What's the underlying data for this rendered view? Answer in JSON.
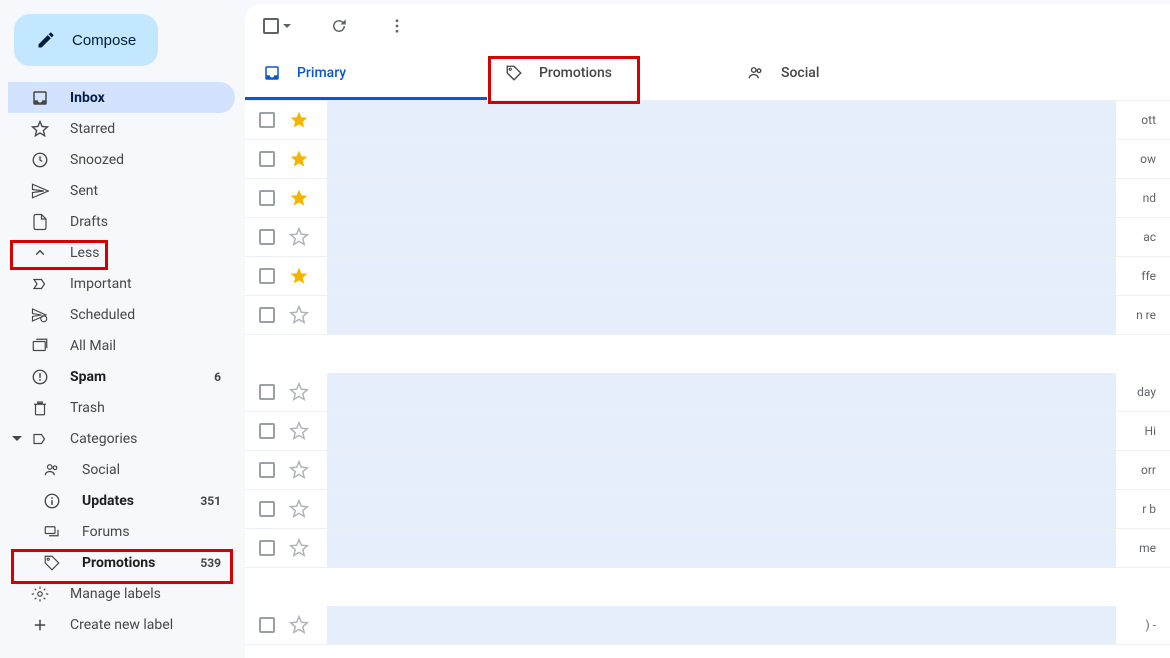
{
  "compose": {
    "label": "Compose"
  },
  "sidebar": {
    "items": [
      {
        "label": "Inbox",
        "count": ""
      },
      {
        "label": "Starred",
        "count": ""
      },
      {
        "label": "Snoozed",
        "count": ""
      },
      {
        "label": "Sent",
        "count": ""
      },
      {
        "label": "Drafts",
        "count": ""
      },
      {
        "label": "Less",
        "count": ""
      },
      {
        "label": "Important",
        "count": ""
      },
      {
        "label": "Scheduled",
        "count": ""
      },
      {
        "label": "All Mail",
        "count": ""
      },
      {
        "label": "Spam",
        "count": "6"
      },
      {
        "label": "Trash",
        "count": ""
      },
      {
        "label": "Categories",
        "count": ""
      },
      {
        "label": "Social",
        "count": ""
      },
      {
        "label": "Updates",
        "count": "351"
      },
      {
        "label": "Forums",
        "count": ""
      },
      {
        "label": "Promotions",
        "count": "539"
      },
      {
        "label": "Manage labels",
        "count": ""
      },
      {
        "label": "Create new label",
        "count": ""
      }
    ]
  },
  "tabs": {
    "primary": "Primary",
    "promotions": "Promotions",
    "social": "Social"
  },
  "emails": [
    {
      "starred": true,
      "tail": "ott"
    },
    {
      "starred": true,
      "tail": "ow"
    },
    {
      "starred": true,
      "tail": "nd"
    },
    {
      "starred": false,
      "tail": "ac"
    },
    {
      "starred": true,
      "tail": "ffe"
    },
    {
      "starred": false,
      "tail": "n re"
    },
    {
      "spacer": true
    },
    {
      "starred": false,
      "tail": "day"
    },
    {
      "starred": false,
      "tail": "Hi"
    },
    {
      "starred": false,
      "tail": "orr"
    },
    {
      "starred": false,
      "tail": "r b"
    },
    {
      "starred": false,
      "tail": "me"
    },
    {
      "spacer": true
    },
    {
      "starred": false,
      "tail": ") -"
    }
  ]
}
